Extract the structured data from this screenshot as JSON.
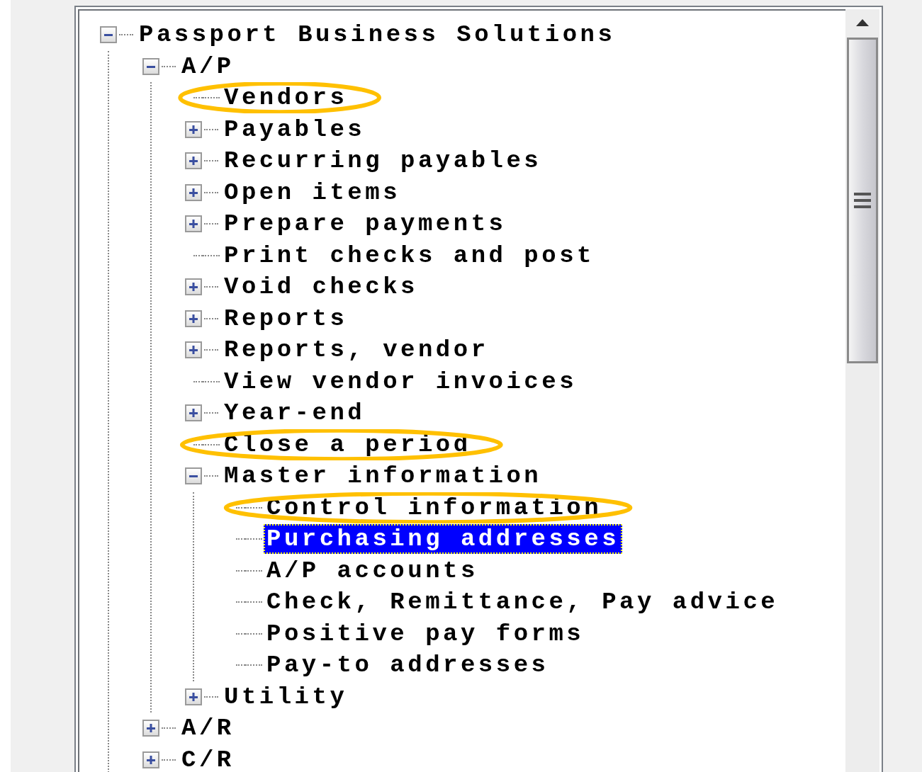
{
  "tree": {
    "label": "Passport Business Solutions",
    "expanded": true,
    "selected": false,
    "circled": false,
    "children": [
      {
        "label": "A/P",
        "expanded": true,
        "selected": false,
        "circled": false,
        "children": [
          {
            "label": "Vendors",
            "selected": false,
            "circled": true
          },
          {
            "label": "Payables",
            "expanded": false,
            "selected": false,
            "circled": false
          },
          {
            "label": "Recurring payables",
            "expanded": false,
            "selected": false,
            "circled": false
          },
          {
            "label": "Open items",
            "expanded": false,
            "selected": false,
            "circled": false
          },
          {
            "label": "Prepare payments",
            "expanded": false,
            "selected": false,
            "circled": false
          },
          {
            "label": "Print checks and post",
            "selected": false,
            "circled": false
          },
          {
            "label": "Void checks",
            "expanded": false,
            "selected": false,
            "circled": false
          },
          {
            "label": "Reports",
            "expanded": false,
            "selected": false,
            "circled": false
          },
          {
            "label": "Reports, vendor",
            "expanded": false,
            "selected": false,
            "circled": false
          },
          {
            "label": "View vendor invoices",
            "selected": false,
            "circled": false
          },
          {
            "label": "Year-end",
            "expanded": false,
            "selected": false,
            "circled": false
          },
          {
            "label": "Close a period",
            "selected": false,
            "circled": true
          },
          {
            "label": "Master information",
            "expanded": true,
            "selected": false,
            "circled": false,
            "children": [
              {
                "label": "Control information",
                "selected": false,
                "circled": true
              },
              {
                "label": "Purchasing addresses",
                "selected": true,
                "circled": false
              },
              {
                "label": "A/P accounts",
                "selected": false,
                "circled": false
              },
              {
                "label": "Check, Remittance, Pay advice",
                "selected": false,
                "circled": false
              },
              {
                "label": "Positive pay forms",
                "selected": false,
                "circled": false
              },
              {
                "label": "Pay-to addresses",
                "selected": false,
                "circled": false
              }
            ]
          },
          {
            "label": "Utility",
            "expanded": false,
            "selected": false,
            "circled": false
          }
        ]
      },
      {
        "label": "A/R",
        "expanded": false,
        "selected": false,
        "circled": false
      },
      {
        "label": "C/R",
        "expanded": false,
        "selected": false,
        "circled": false
      }
    ]
  }
}
